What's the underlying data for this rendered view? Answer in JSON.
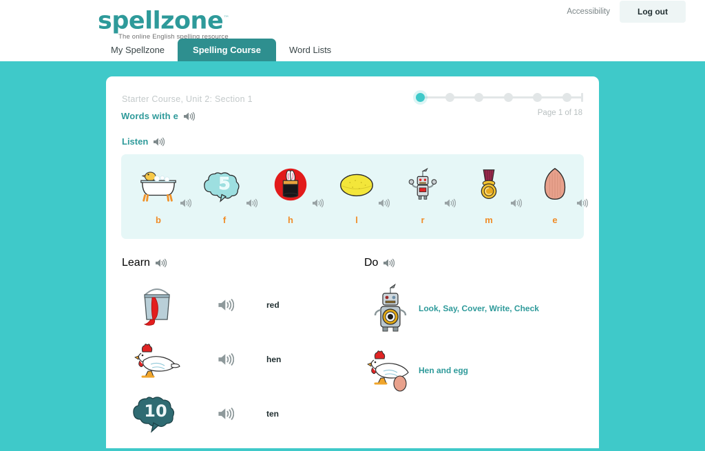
{
  "header": {
    "logo_word": "spellzone",
    "logo_tm": "™",
    "logo_tagline": "The online English spelling resource",
    "accessibility_label": "Accessibility",
    "logout_label": "Log out"
  },
  "tabs": [
    {
      "label": "My Spellzone",
      "active": false
    },
    {
      "label": "Spelling Course",
      "active": true
    },
    {
      "label": "Word Lists",
      "active": false
    }
  ],
  "course": {
    "breadcrumb": "Starter Course, Unit 2: Section 1",
    "title": "Words with e",
    "page_label": "Page 1 of 18",
    "progress_total_dots": 6,
    "progress_active_index": 0
  },
  "listen": {
    "heading": "Listen",
    "items": [
      {
        "letter": "b",
        "image": "bath-image",
        "speaker": "speaker-icon"
      },
      {
        "letter": "f",
        "image": "five-cloud-image",
        "speaker": "speaker-icon"
      },
      {
        "letter": "h",
        "image": "hat-rabbit-image",
        "speaker": "speaker-icon"
      },
      {
        "letter": "l",
        "image": "lemon-image",
        "speaker": "speaker-icon"
      },
      {
        "letter": "r",
        "image": "robot-image",
        "speaker": "speaker-icon"
      },
      {
        "letter": "m",
        "image": "medal-image",
        "speaker": "speaker-icon"
      },
      {
        "letter": "e",
        "image": "egg-image",
        "speaker": "speaker-icon"
      }
    ]
  },
  "learn": {
    "heading": "Learn",
    "rows": [
      {
        "word": "red",
        "image": "paint-can-image",
        "speaker": "speaker-icon"
      },
      {
        "word": "hen",
        "image": "hen-image",
        "speaker": "speaker-icon"
      },
      {
        "word": "ten",
        "image": "ten-cloud-image",
        "speaker": "speaker-icon"
      }
    ]
  },
  "do": {
    "heading": "Do",
    "activities": [
      {
        "label": "Look, Say, Cover, Write, Check",
        "image": "robot-image"
      },
      {
        "label": "Hen and egg",
        "image": "hen-egg-image"
      }
    ]
  },
  "colors": {
    "brand_teal": "#2e9a9a",
    "page_teal": "#3fc9c9",
    "panel_cyan": "#e6f7f7",
    "letter_orange": "#f08c28",
    "muted_grey": "#c3c9ca"
  }
}
